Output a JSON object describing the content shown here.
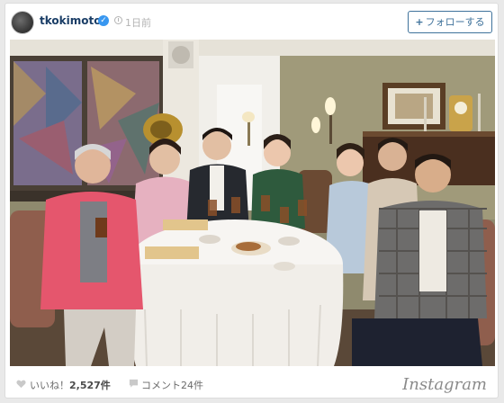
{
  "post": {
    "username": "tkokimoto",
    "time": "1日前",
    "follow_label": "フォローする",
    "follow_plus": "+"
  },
  "footer": {
    "likes_label": "いいね！",
    "likes_count": "2,527件",
    "comments_label": "コメント24件",
    "logo": "Instagram"
  },
  "icons": {
    "verified": "verified-badge-icon",
    "clock": "clock-icon",
    "heart": "heart-icon",
    "comment": "comment-icon"
  },
  "colors": {
    "username": "#1a3d66",
    "follow_button": "#3f729b",
    "verified": "#3897f0"
  }
}
